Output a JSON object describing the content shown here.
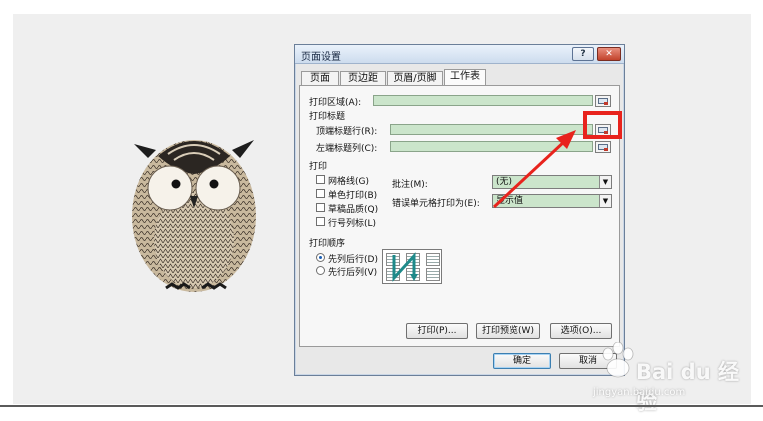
{
  "dialog": {
    "title": "页面设置",
    "help_button": "?",
    "close_button": "✕",
    "tabs": [
      {
        "label": "页面"
      },
      {
        "label": "页边距"
      },
      {
        "label": "页眉/页脚"
      },
      {
        "label": "工作表",
        "active": true
      }
    ]
  },
  "sheet": {
    "print_area_label": "打印区域(A):",
    "print_titles_label": "打印标题",
    "top_rows_label": "顶端标题行(R):",
    "left_cols_label": "左端标题列(C):",
    "print_section_label": "打印",
    "checkboxes": [
      {
        "label": "网格线(G)"
      },
      {
        "label": "单色打印(B)"
      },
      {
        "label": "草稿品质(Q)"
      },
      {
        "label": "行号列标(L)"
      }
    ],
    "comments_label": "批注(M):",
    "comments_value": "(无)",
    "errors_label": "错误单元格打印为(E):",
    "errors_value": "显示值",
    "page_order_label": "打印顺序",
    "radios": [
      {
        "label": "先列后行(D)",
        "selected": true
      },
      {
        "label": "先行后列(V)",
        "selected": false
      }
    ]
  },
  "buttons": {
    "print": "打印(P)...",
    "preview": "打印预览(W)",
    "options": "选项(O)...",
    "ok": "确定",
    "cancel": "取消"
  },
  "watermark": {
    "brand": "Bai du 经验",
    "url": "jingyan.baidu.com"
  },
  "colors": {
    "highlight": "#e8231d",
    "field_green": "#cbe5cb",
    "panel_bg": "#efefef"
  },
  "icons": [
    "owl-illustration",
    "collapse-dialog-icon",
    "dropdown-arrow-icon",
    "page-order-icon",
    "baidu-paw-icon"
  ]
}
